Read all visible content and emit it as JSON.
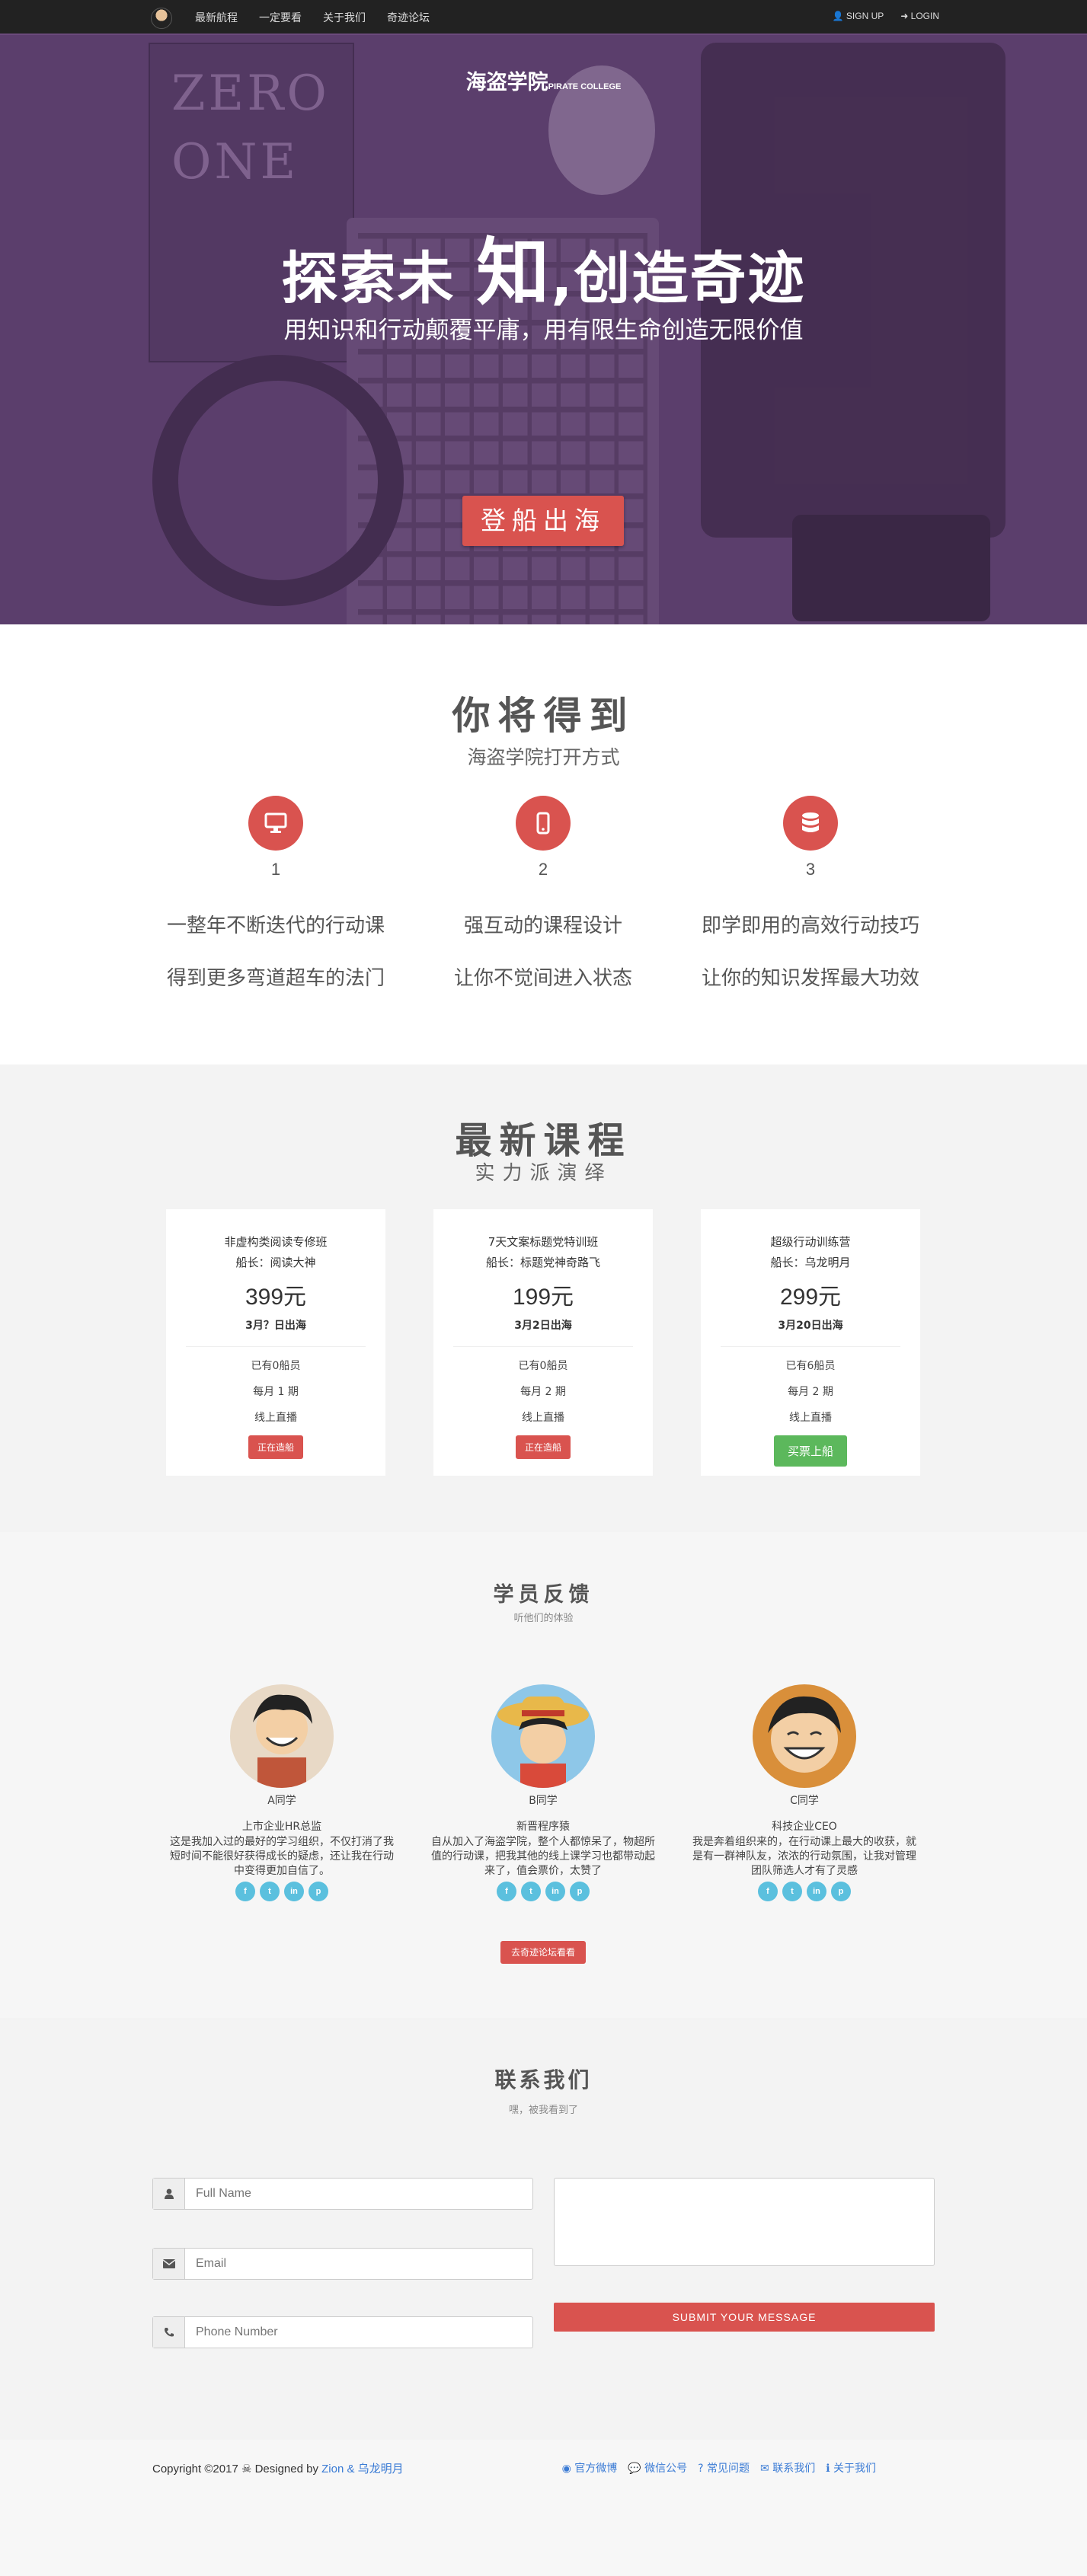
{
  "nav": {
    "links": [
      "最新航程",
      "一定要看",
      "关于我们",
      "奇迹论坛"
    ],
    "signup": "SIGN UP",
    "login": "LOGIN"
  },
  "hero": {
    "brand_cn": "海盗学院",
    "brand_en": "PIRATE COLLEGE",
    "title_a": "探索未 ",
    "title_b": "知",
    "title_c": ",创造奇迹",
    "subtitle": "用知识和行动颠覆平庸，用有限生命创造无限价值",
    "cta": "登船出海",
    "bg_book_text_1": "ZERO",
    "bg_book_text_2": "ONE"
  },
  "features": {
    "title": "你将得到",
    "subtitle": "海盗学院打开方式",
    "items": [
      {
        "icon": "monitor-icon",
        "num": "1",
        "line1": "一整年不断迭代的行动课",
        "line2": "得到更多弯道超车的法门"
      },
      {
        "icon": "mobile-icon",
        "num": "2",
        "line1": "强互动的课程设计",
        "line2": "让你不觉间进入状态"
      },
      {
        "icon": "database-icon",
        "num": "3",
        "line1": "即学即用的高效行动技巧",
        "line2": "让你的知识发挥最大功效"
      }
    ]
  },
  "courses": {
    "title": "最新课程",
    "subtitle": "实力派演绎",
    "items": [
      {
        "name": "非虚构类阅读专修班",
        "captain": "船长：阅读大神",
        "price": "399元",
        "date": "3月？日出海",
        "members": "已有0船员",
        "freq": "每月 1 期",
        "mode": "线上直播",
        "button": "正在造船"
      },
      {
        "name": "7天文案标题党特训班",
        "captain": "船长：标题党神奇路飞",
        "price": "199元",
        "date": "3月2日出海",
        "members": "已有0船员",
        "freq": "每月 2 期",
        "mode": "线上直播",
        "button": "正在造船"
      },
      {
        "name": "超级行动训练营",
        "captain": "船长：乌龙明月",
        "price": "299元",
        "date": "3月20日出海",
        "members": "已有6船员",
        "freq": "每月 2 期",
        "mode": "线上直播",
        "button": "买票上船"
      }
    ]
  },
  "feedback": {
    "title": "学员反馈",
    "subtitle": "听他们的体验",
    "people": [
      {
        "name": "A同学",
        "role": "上市企业HR总监",
        "quote": "这是我加入过的最好的学习组织，不仅打消了我短时间不能很好获得成长的疑虑，还让我在行动中变得更加自信了。"
      },
      {
        "name": "B同学",
        "role": "新晋程序猿",
        "quote": "自从加入了海盗学院，整个人都惊呆了，物超所值的行动课，把我其他的线上课学习也都带动起来了，值会票价，太赞了"
      },
      {
        "name": "C同学",
        "role": "科技企业CEO",
        "quote": "我是奔着组织来的，在行动课上最大的收获，就是有一群神队友，浓浓的行动氛围，让我对管理团队筛选人才有了灵感"
      }
    ],
    "social": [
      "f",
      "t",
      "in",
      "p"
    ],
    "forum_button": "去奇迹论坛看看"
  },
  "contact": {
    "title": "联系我们",
    "subtitle": "嘿，被我看到了",
    "name_placeholder": "Full Name",
    "email_placeholder": "Email",
    "phone_placeholder": "Phone Number",
    "submit": "SUBMIT YOUR MESSAGE"
  },
  "footer": {
    "copy": "Copyright ©2017 ",
    "designed": " Designed by ",
    "author": "Zion & 乌龙明月",
    "links": [
      "官方微博",
      "微信公号",
      "常见问题",
      "联系我们",
      "关于我们"
    ]
  },
  "colors": {
    "accent": "#d9534f",
    "green": "#5cb85c",
    "hero_purple": "#5b3f6b",
    "social": "#5bc0de",
    "link": "#3a7bd5"
  }
}
